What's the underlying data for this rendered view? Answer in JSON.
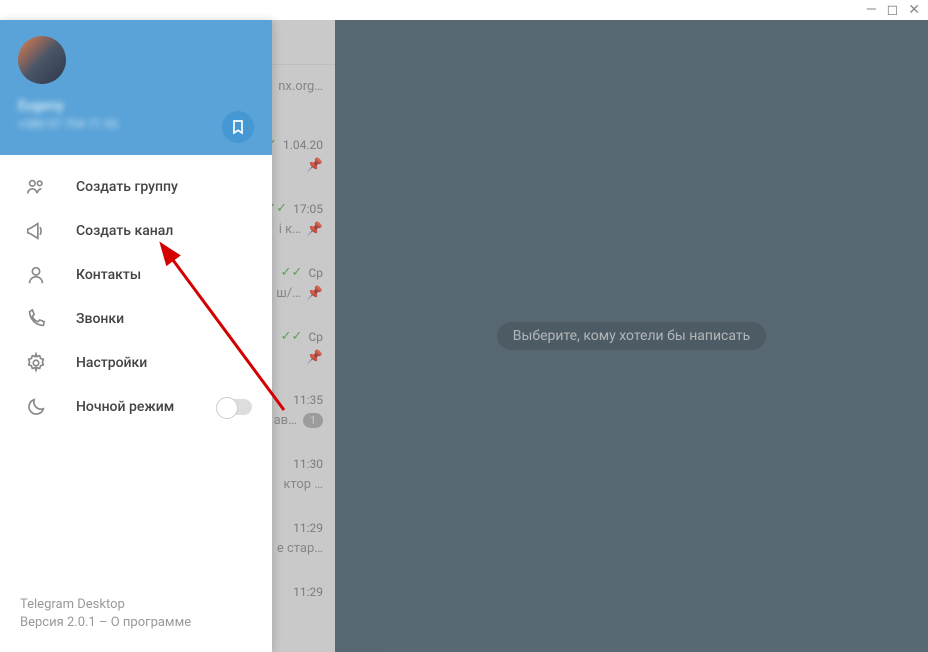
{
  "window": {
    "minimize": "—",
    "maximize": "◻",
    "close": "✕"
  },
  "user": {
    "name": "Eugeny",
    "phone": "+380 97 794 71 95"
  },
  "menu": {
    "new_group": "Создать группу",
    "new_channel": "Создать канал",
    "contacts": "Контакты",
    "calls": "Звонки",
    "settings": "Настройки",
    "night_mode": "Ночной режим"
  },
  "footer": {
    "app_name": "Telegram Desktop",
    "version_prefix": "Версия 2.0.1 – ",
    "about": "О программе"
  },
  "chats": [
    {
      "time": "",
      "preview": "nx.org…",
      "checks": false,
      "pin": false
    },
    {
      "time": "1.04.20",
      "preview": "",
      "checks": true,
      "pin": true
    },
    {
      "time": "17:05",
      "preview": "і к…",
      "checks": true,
      "pin": true
    },
    {
      "time": "Ср",
      "preview": "ш/…",
      "checks": true,
      "pin": true
    },
    {
      "time": "Ср",
      "preview": "",
      "checks": true,
      "pin": true
    },
    {
      "time": "11:35",
      "preview": "ав…",
      "checks": false,
      "badge": "1"
    },
    {
      "time": "11:30",
      "preview": "ктор …",
      "checks": false
    },
    {
      "time": "11:29",
      "preview": "е  стар…",
      "checks": false
    },
    {
      "time": "11:29",
      "preview": "",
      "checks": false
    }
  ],
  "placeholder": "Выберите, кому хотели бы написать"
}
